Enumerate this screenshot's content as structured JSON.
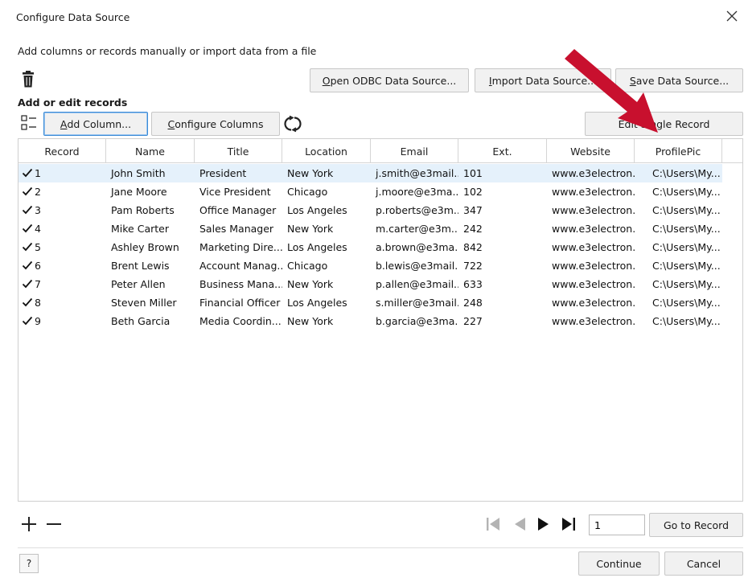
{
  "dialog": {
    "title": "Configure Data Source",
    "subtitle": "Add columns or records manually or import data from a file",
    "section_label": "Add or edit records"
  },
  "toolbar": {
    "open_odbc_mn": "O",
    "open_odbc_rest": "pen ODBC Data Source...",
    "import_mn": "I",
    "import_rest": "mport Data Source...",
    "save_mn": "S",
    "save_rest": "ave Data Source...",
    "add_column_mn": "A",
    "add_column_rest": "dd Column...",
    "configure_columns_mn": "C",
    "configure_columns_rest": "onfigure Columns",
    "single_record_label": "Edit Single Record"
  },
  "table": {
    "columns": [
      "Record",
      "Name",
      "Title",
      "Location",
      "Email",
      "Ext.",
      "Website",
      "ProfilePic"
    ],
    "rows": [
      {
        "record": "1",
        "checked": true,
        "name": "John Smith",
        "title": "President",
        "location": "New York",
        "email": "j.smith@e3mail....",
        "ext": "101",
        "website": "www.e3electron...",
        "pic": "C:\\Users\\My..."
      },
      {
        "record": "2",
        "checked": true,
        "name": "Jane Moore",
        "title": "Vice President",
        "location": "Chicago",
        "email": "j.moore@e3ma...",
        "ext": "102",
        "website": "www.e3electron...",
        "pic": "C:\\Users\\My..."
      },
      {
        "record": "3",
        "checked": true,
        "name": "Pam Roberts",
        "title": "Office Manager",
        "location": "Los Angeles",
        "email": "p.roberts@e3m...",
        "ext": "347",
        "website": "www.e3electron...",
        "pic": "C:\\Users\\My..."
      },
      {
        "record": "4",
        "checked": true,
        "name": "Mike Carter",
        "title": "Sales Manager",
        "location": "New York",
        "email": "m.carter@e3m...",
        "ext": "242",
        "website": "www.e3electron...",
        "pic": "C:\\Users\\My..."
      },
      {
        "record": "5",
        "checked": true,
        "name": "Ashley Brown",
        "title": "Marketing Dire...",
        "location": "Los Angeles",
        "email": "a.brown@e3ma...",
        "ext": "842",
        "website": "www.e3electron...",
        "pic": "C:\\Users\\My..."
      },
      {
        "record": "6",
        "checked": true,
        "name": "Brent Lewis",
        "title": "Account Manag...",
        "location": "Chicago",
        "email": "b.lewis@e3mail...",
        "ext": "722",
        "website": "www.e3electron...",
        "pic": "C:\\Users\\My..."
      },
      {
        "record": "7",
        "checked": true,
        "name": "Peter Allen",
        "title": "Business Mana...",
        "location": "New York",
        "email": "p.allen@e3mail....",
        "ext": "633",
        "website": "www.e3electron...",
        "pic": "C:\\Users\\My..."
      },
      {
        "record": "8",
        "checked": true,
        "name": "Steven Miller",
        "title": "Financial Officer",
        "location": "Los Angeles",
        "email": "s.miller@e3mail...",
        "ext": "248",
        "website": "www.e3electron...",
        "pic": "C:\\Users\\My..."
      },
      {
        "record": "9",
        "checked": true,
        "name": "Beth Garcia",
        "title": "Media Coordin...",
        "location": "New York",
        "email": "b.garcia@e3ma...",
        "ext": "227",
        "website": "www.e3electron...",
        "pic": "C:\\Users\\My..."
      }
    ]
  },
  "pager": {
    "page_value": "1",
    "go_to_record_label": "Go to Record"
  },
  "footer": {
    "help_label": "?",
    "continue_label": "Continue",
    "cancel_label": "Cancel"
  },
  "icons": {
    "close": "close-icon",
    "delete": "trash-icon",
    "column_list": "column-list-icon",
    "refresh": "refresh-icon",
    "add_record": "plus-icon",
    "remove_record": "minus-icon",
    "first": "first-page-icon",
    "prev": "previous-page-icon",
    "next": "next-page-icon",
    "last": "last-page-icon"
  },
  "colors": {
    "selection": "#e5f1fb",
    "focus_border": "#3a8ad6",
    "annotation_arrow": "#c8102e"
  }
}
